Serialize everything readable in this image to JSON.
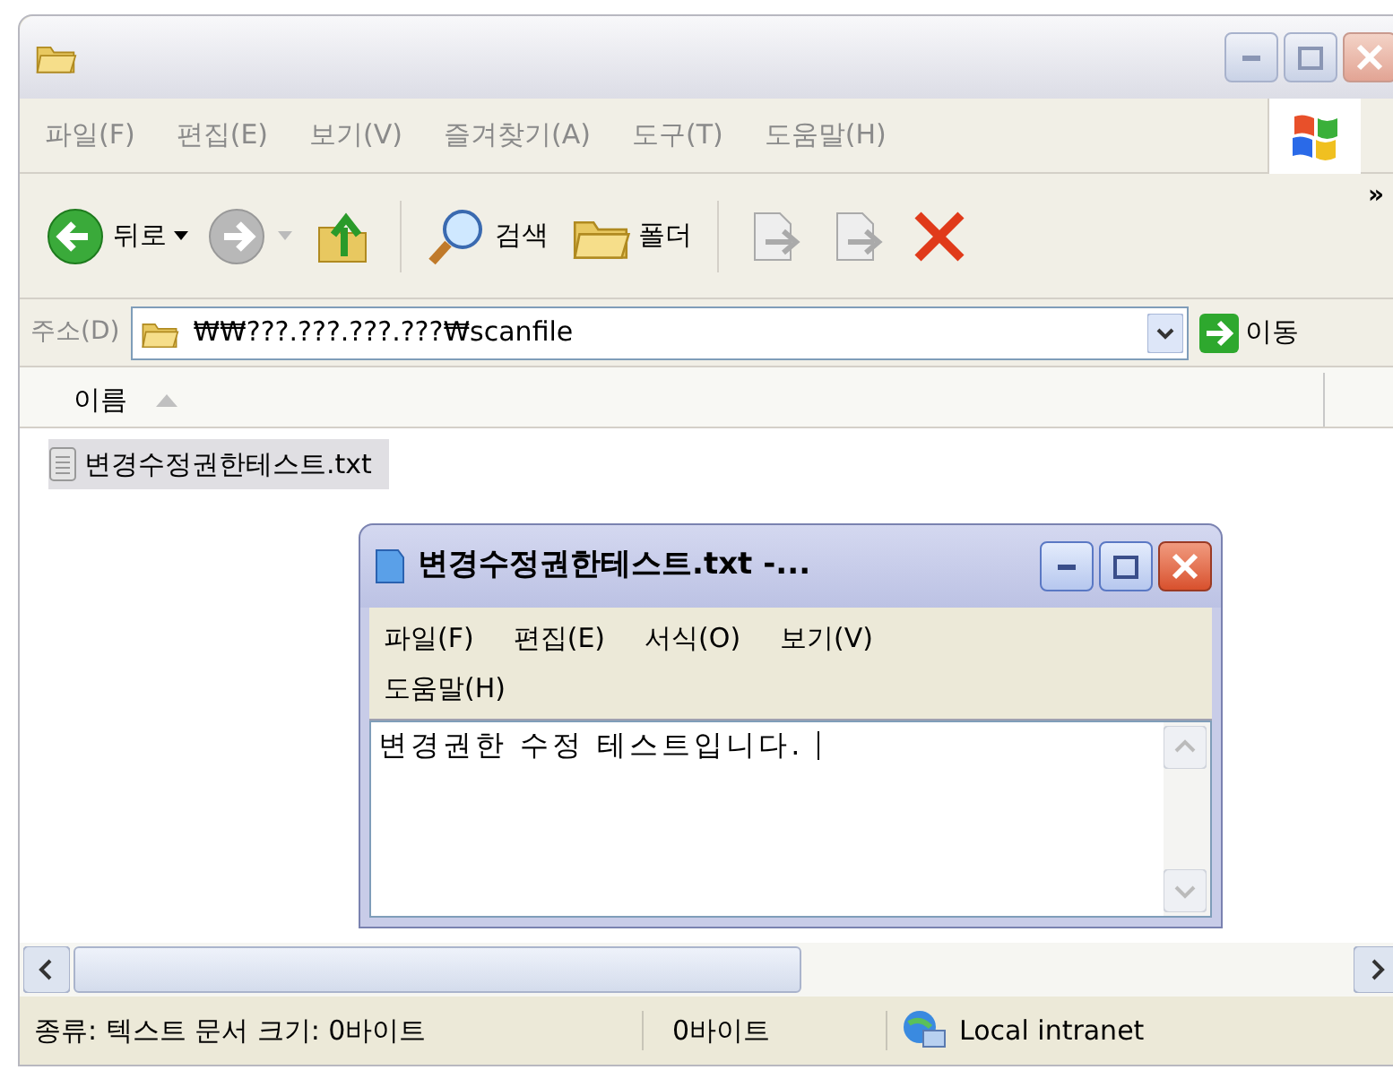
{
  "explorer": {
    "active": false,
    "menu": [
      "파일(F)",
      "편집(E)",
      "보기(V)",
      "즐겨찾기(A)",
      "도구(T)",
      "도움말(H)"
    ],
    "toolbar": [
      {
        "kind": "back",
        "label": "뒤로"
      },
      {
        "kind": "forward"
      },
      {
        "kind": "up"
      },
      {
        "kind": "search",
        "label": "검색"
      },
      {
        "kind": "folders",
        "label": "폴더"
      },
      {
        "kind": "move"
      },
      {
        "kind": "copy"
      },
      {
        "kind": "delete"
      }
    ],
    "overflow": "»",
    "address": {
      "label": "주소(D)",
      "value": "₩₩???.???.???.???₩scanfile",
      "go": "이동"
    },
    "columns": [
      {
        "label": "이름"
      }
    ],
    "files": [
      {
        "name": "변경수정권한테스트.txt",
        "selected": true
      }
    ],
    "status": [
      "종류: 텍스트 문서 크기: 0바이트",
      "0바이트",
      "Local intranet"
    ]
  },
  "notepad": {
    "active": true,
    "title": "변경수정권한테스트.txt -...",
    "menu": [
      "파일(F)",
      "편집(E)",
      "서식(O)",
      "보기(V)",
      "도움말(H)"
    ],
    "text": "변경권한 수정 테스트입니다."
  }
}
